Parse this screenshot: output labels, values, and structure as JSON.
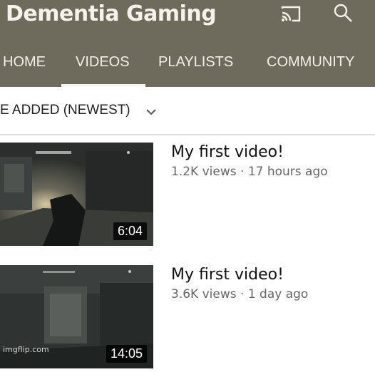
{
  "header": {
    "channel_title": "Dementia Gaming",
    "icons": [
      "cast-icon",
      "search-icon"
    ],
    "background_color": "#6e6b5c"
  },
  "tabs": [
    {
      "label": "HOME",
      "selected": false
    },
    {
      "label": "VIDEOS",
      "selected": true
    },
    {
      "label": "PLAYLISTS",
      "selected": false
    },
    {
      "label": "COMMUNITY",
      "selected": false
    }
  ],
  "sort": {
    "label": "E ADDED (NEWEST)",
    "icon": "chevron-down-icon"
  },
  "videos": [
    {
      "title": "My first video!",
      "views": "1.2K views",
      "age": "17 hours ago",
      "duration": "6:04"
    },
    {
      "title": "My first video!",
      "views": "3.6K views",
      "age": "1 day ago",
      "duration": "14:05"
    }
  ],
  "watermark": "imgflip.com"
}
